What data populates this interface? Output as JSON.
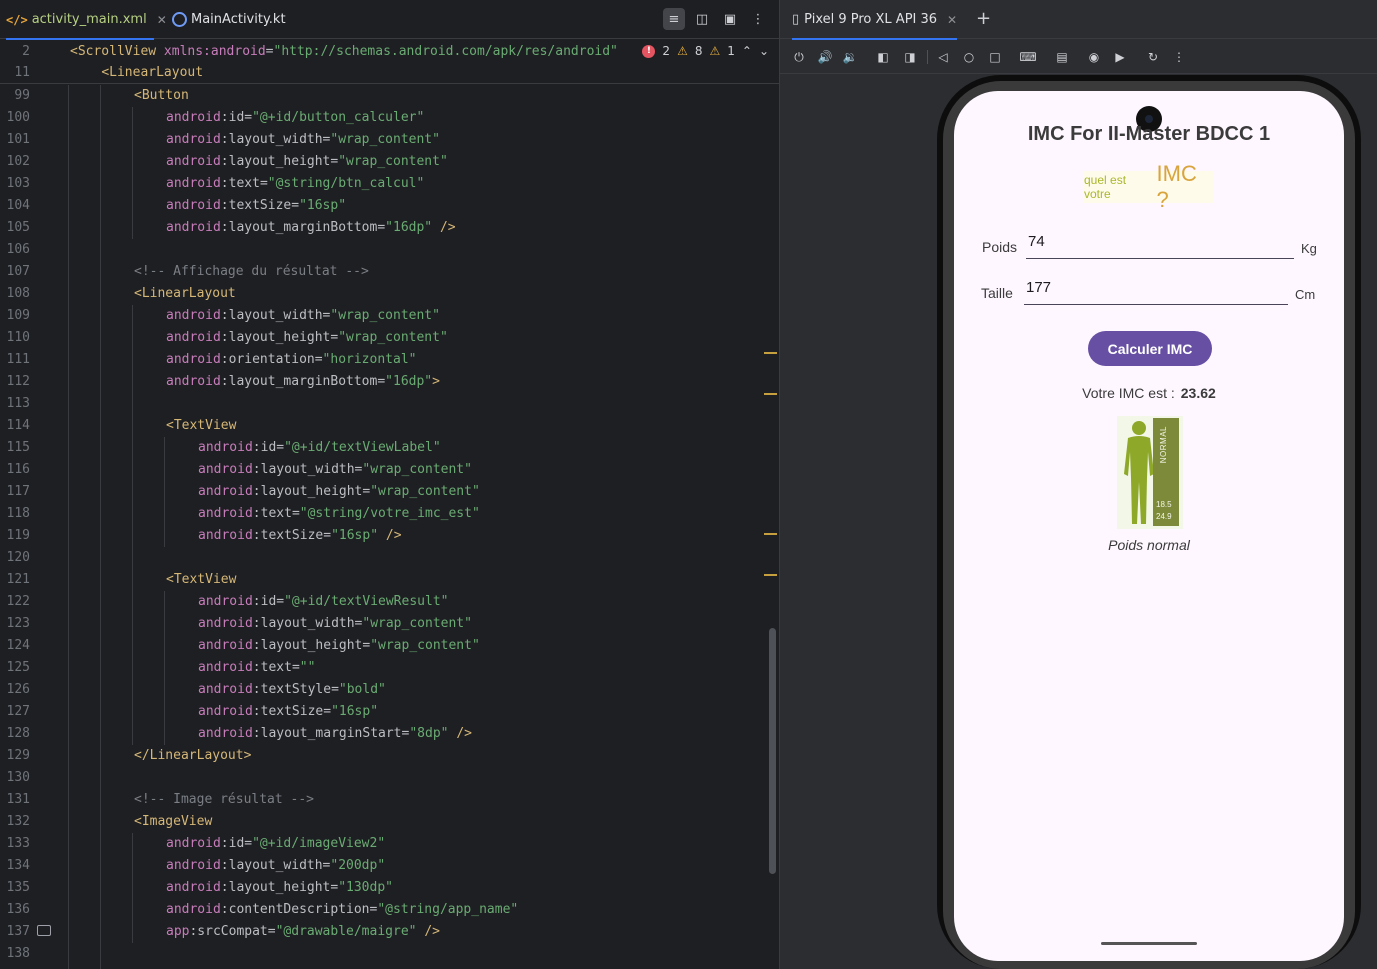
{
  "editor": {
    "tabs": [
      {
        "label": "activity_main.xml",
        "icon": "xml-file-icon",
        "active": true
      },
      {
        "label": "MainActivity.kt",
        "icon": "kotlin-file-icon",
        "active": false
      }
    ],
    "inspections": {
      "errors": "2",
      "warnings": "8",
      "weak_warnings": "1"
    },
    "breadcrumbs": [
      {
        "ln": "2",
        "html": "<span class='tag'>&lt;ScrollView</span> <span class='ns'>xmlns:android</span><span class='punc'>=</span><span class='val'>\"http://schemas.android.com/apk/res/android\"</span>"
      },
      {
        "ln": "11",
        "html": "    <span class='tag'>&lt;LinearLayout</span>"
      }
    ],
    "lines": [
      {
        "ln": "99",
        "indent": 8,
        "html": "<span class='tag'>&lt;Button</span>"
      },
      {
        "ln": "100",
        "indent": 12,
        "html": "<span class='ns'>android</span><span class='attr'>:id</span>=<span class='val'>\"@+id/button_calculer\"</span>"
      },
      {
        "ln": "101",
        "indent": 12,
        "html": "<span class='ns'>android</span><span class='attr'>:layout_width</span>=<span class='val'>\"wrap_content\"</span>"
      },
      {
        "ln": "102",
        "indent": 12,
        "html": "<span class='ns'>android</span><span class='attr'>:layout_height</span>=<span class='val'>\"wrap_content\"</span>"
      },
      {
        "ln": "103",
        "indent": 12,
        "html": "<span class='ns'>android</span><span class='attr'>:text</span>=<span class='val'>\"@string/btn_calcul\"</span>"
      },
      {
        "ln": "104",
        "indent": 12,
        "html": "<span class='ns'>android</span><span class='attr'>:textSize</span>=<span class='val'>\"16sp\"</span>"
      },
      {
        "ln": "105",
        "indent": 12,
        "html": "<span class='ns'>android</span><span class='attr'>:layout_marginBottom</span>=<span class='val'>\"16dp\"</span> <span class='tag'>/&gt;</span>"
      },
      {
        "ln": "106",
        "indent": 0,
        "html": ""
      },
      {
        "ln": "107",
        "indent": 8,
        "html": "<span class='cmt'>&lt;!-- Affichage du résultat --&gt;</span>"
      },
      {
        "ln": "108",
        "indent": 8,
        "html": "<span class='tag'>&lt;LinearLayout</span>"
      },
      {
        "ln": "109",
        "indent": 12,
        "html": "<span class='ns'>android</span><span class='attr'>:layout_width</span>=<span class='val'>\"wrap_content\"</span>"
      },
      {
        "ln": "110",
        "indent": 12,
        "html": "<span class='ns'>android</span><span class='attr'>:layout_height</span>=<span class='val'>\"wrap_content\"</span>"
      },
      {
        "ln": "111",
        "indent": 12,
        "html": "<span class='ns'>android</span><span class='attr'>:orientation</span>=<span class='val'>\"horizontal\"</span>"
      },
      {
        "ln": "112",
        "indent": 12,
        "html": "<span class='ns'>android</span><span class='attr'>:layout_marginBottom</span>=<span class='val'>\"16dp\"</span><span class='tag'>&gt;</span>"
      },
      {
        "ln": "113",
        "indent": 0,
        "html": ""
      },
      {
        "ln": "114",
        "indent": 12,
        "html": "<span class='tag'>&lt;TextView</span>"
      },
      {
        "ln": "115",
        "indent": 16,
        "html": "<span class='ns'>android</span><span class='attr'>:id</span>=<span class='val'>\"@+id/textViewLabel\"</span>"
      },
      {
        "ln": "116",
        "indent": 16,
        "html": "<span class='ns'>android</span><span class='attr'>:layout_width</span>=<span class='val'>\"wrap_content\"</span>"
      },
      {
        "ln": "117",
        "indent": 16,
        "html": "<span class='ns'>android</span><span class='attr'>:layout_height</span>=<span class='val'>\"wrap_content\"</span>"
      },
      {
        "ln": "118",
        "indent": 16,
        "html": "<span class='ns'>android</span><span class='attr'>:text</span>=<span class='val'>\"@string/votre_imc_est\"</span>"
      },
      {
        "ln": "119",
        "indent": 16,
        "html": "<span class='ns'>android</span><span class='attr'>:textSize</span>=<span class='val'>\"16sp\"</span> <span class='tag'>/&gt;</span>"
      },
      {
        "ln": "120",
        "indent": 0,
        "html": ""
      },
      {
        "ln": "121",
        "indent": 12,
        "html": "<span class='tag'>&lt;TextView</span>"
      },
      {
        "ln": "122",
        "indent": 16,
        "html": "<span class='ns'>android</span><span class='attr'>:id</span>=<span class='val'>\"@+id/textViewResult\"</span>"
      },
      {
        "ln": "123",
        "indent": 16,
        "html": "<span class='ns'>android</span><span class='attr'>:layout_width</span>=<span class='val'>\"wrap_content\"</span>"
      },
      {
        "ln": "124",
        "indent": 16,
        "html": "<span class='ns'>android</span><span class='attr'>:layout_height</span>=<span class='val'>\"wrap_content\"</span>"
      },
      {
        "ln": "125",
        "indent": 16,
        "html": "<span class='ns'>android</span><span class='attr'>:text</span>=<span class='val'>\"\"</span>"
      },
      {
        "ln": "126",
        "indent": 16,
        "html": "<span class='ns'>android</span><span class='attr'>:textStyle</span>=<span class='val'>\"bold\"</span>"
      },
      {
        "ln": "127",
        "indent": 16,
        "html": "<span class='ns'>android</span><span class='attr'>:textSize</span>=<span class='val'>\"16sp\"</span>"
      },
      {
        "ln": "128",
        "indent": 16,
        "html": "<span class='ns'>android</span><span class='attr'>:layout_marginStart</span>=<span class='val'>\"8dp\"</span> <span class='tag'>/&gt;</span>"
      },
      {
        "ln": "129",
        "indent": 8,
        "html": "<span class='tag'>&lt;/LinearLayout&gt;</span>"
      },
      {
        "ln": "130",
        "indent": 0,
        "html": ""
      },
      {
        "ln": "131",
        "indent": 8,
        "html": "<span class='cmt'>&lt;!-- Image résultat --&gt;</span>"
      },
      {
        "ln": "132",
        "indent": 8,
        "html": "<span class='tag'>&lt;ImageView</span>"
      },
      {
        "ln": "133",
        "indent": 12,
        "html": "<span class='ns'>android</span><span class='attr'>:id</span>=<span class='val'>\"@+id/imageView2\"</span>"
      },
      {
        "ln": "134",
        "indent": 12,
        "html": "<span class='ns'>android</span><span class='attr'>:layout_width</span>=<span class='val'>\"200dp\"</span>"
      },
      {
        "ln": "135",
        "indent": 12,
        "html": "<span class='ns'>android</span><span class='attr'>:layout_height</span>=<span class='val'>\"130dp\"</span>"
      },
      {
        "ln": "136",
        "indent": 12,
        "html": "<span class='ns'>android</span><span class='attr'>:contentDescription</span>=<span class='val'>\"@string/app_name\"</span>"
      },
      {
        "ln": "137",
        "indent": 12,
        "html": "<span class='ns'>app</span><span class='attr'>:srcCompat</span>=<span class='val'>\"@drawable/maigre\"</span> <span class='tag'>/&gt;</span>"
      },
      {
        "ln": "138",
        "indent": 0,
        "html": ""
      }
    ]
  },
  "emulator": {
    "device_tab": "Pixel 9 Pro XL API 36",
    "app": {
      "title": "IMC For II-Master BDCC 1",
      "logo_small": "quel est votre",
      "logo_big": "IMC ?",
      "weight_label": "Poids",
      "weight_value": "74",
      "weight_unit": "Kg",
      "height_label": "Taille",
      "height_value": "177",
      "height_unit": "Cm",
      "button": "Calculer IMC",
      "result_label": "Votre IMC est :",
      "result_value": "23.62",
      "figure_band": "NORMAL",
      "figure_range_low": "18.5",
      "figure_range_high": "24.9",
      "caption": "Poids normal"
    }
  },
  "colors": {
    "accent": "#3574f0",
    "button": "#6750a4",
    "screen_bg": "#fef7ff"
  }
}
